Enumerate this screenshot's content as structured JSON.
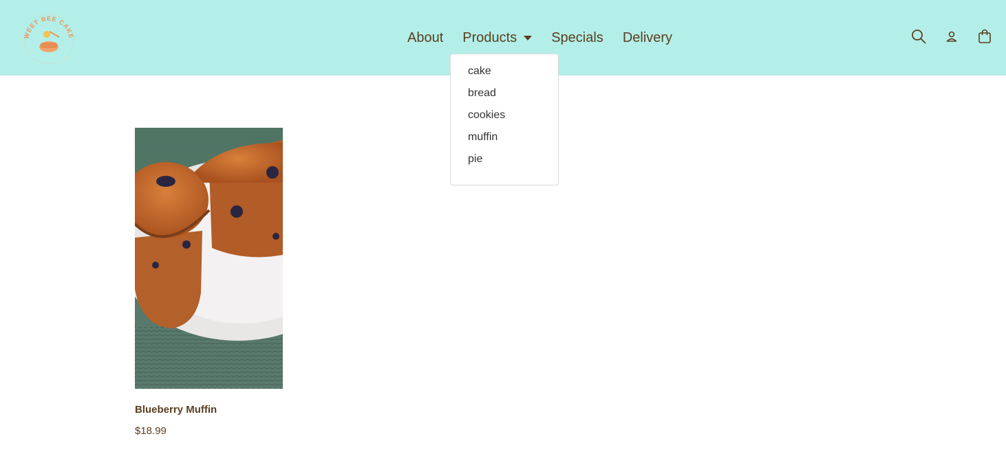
{
  "brand": {
    "logo_text": "SWEET BEE CAKES"
  },
  "nav": {
    "items": [
      {
        "label": "About"
      },
      {
        "label": "Products"
      },
      {
        "label": "Specials"
      },
      {
        "label": "Delivery"
      }
    ]
  },
  "header_icons": [
    "search-icon",
    "account-icon",
    "cart-bag-icon"
  ],
  "products_menu": {
    "items": [
      "cake",
      "bread",
      "cookies",
      "muffin",
      "pie"
    ]
  },
  "product": {
    "name": "Blueberry Muffin",
    "price": "$18.99"
  },
  "colors": {
    "header_bg": "#b3efe8",
    "text_brown": "#5a3e1f",
    "logo_orange": "#e89a5a"
  }
}
